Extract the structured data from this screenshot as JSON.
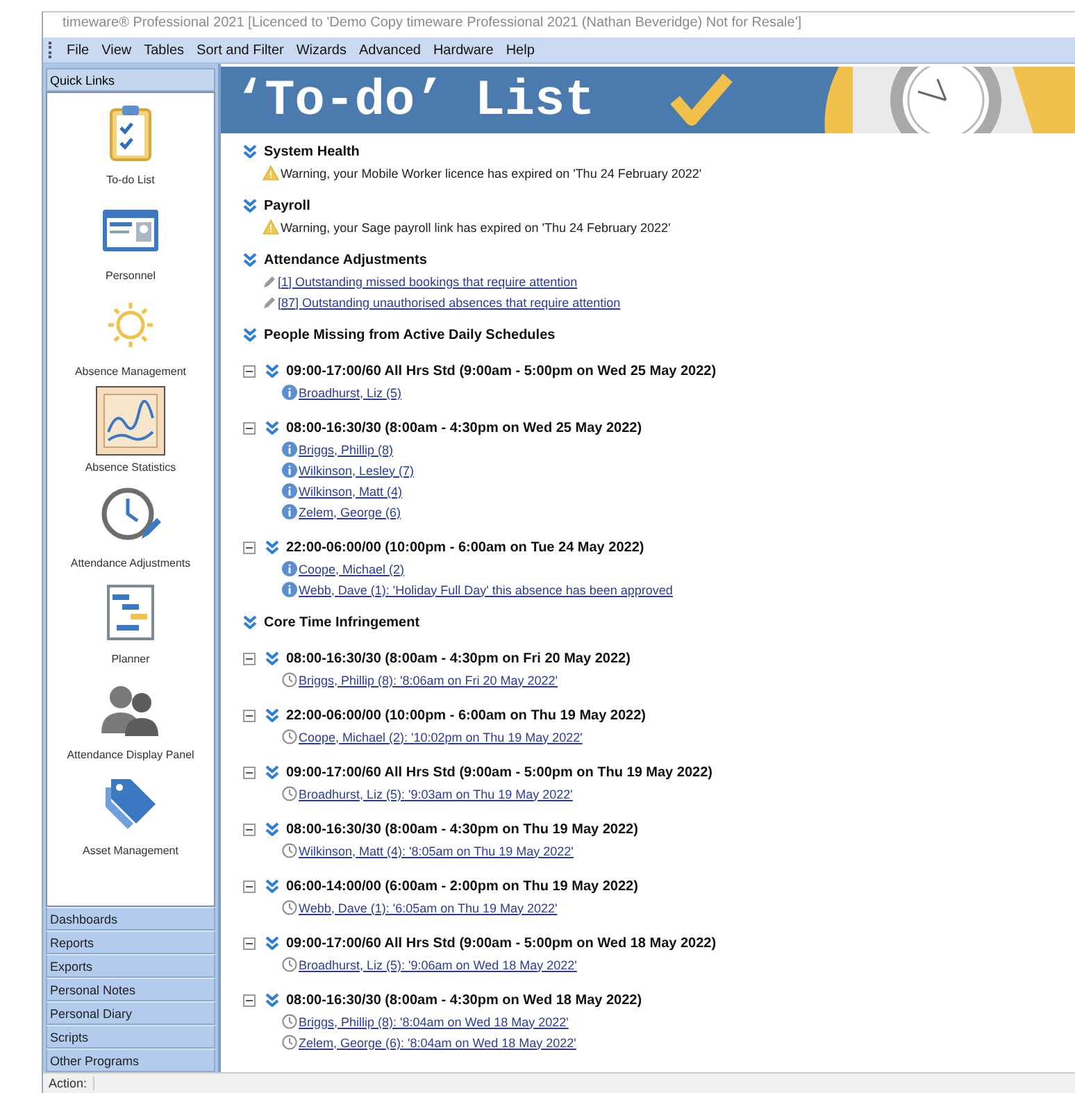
{
  "window": {
    "title": "timeware® Professional 2021 [Licenced to 'Demo Copy timeware Professional 2021 (Nathan Beveridge) Not for Resale']"
  },
  "menu": [
    "File",
    "View",
    "Tables",
    "Sort and Filter",
    "Wizards",
    "Advanced",
    "Hardware",
    "Help"
  ],
  "sidebar": {
    "header": "Quick Links",
    "quick_links": [
      {
        "label": "To-do List",
        "kind": "clipboard",
        "selected": false
      },
      {
        "label": "Personnel",
        "kind": "card",
        "selected": false
      },
      {
        "label": "Absence Management",
        "kind": "sun",
        "selected": false
      },
      {
        "label": "Absence Statistics",
        "kind": "chart",
        "selected": true
      },
      {
        "label": "Attendance Adjustments",
        "kind": "clock",
        "selected": false
      },
      {
        "label": "Planner",
        "kind": "gantt",
        "selected": false
      },
      {
        "label": "Attendance Display Panel",
        "kind": "people",
        "selected": false
      },
      {
        "label": "Asset Management",
        "kind": "tags",
        "selected": false
      }
    ],
    "bottom_items": [
      "Dashboards",
      "Reports",
      "Exports",
      "Personal Notes",
      "Personal Diary",
      "Scripts",
      "Other Programs"
    ]
  },
  "banner": {
    "title": "‘To-do’ List"
  },
  "sections": [
    {
      "title": "System Health",
      "items": [
        {
          "kind": "warning",
          "text": "Warning, your Mobile Worker licence has expired on 'Thu 24 February 2022'"
        }
      ]
    },
    {
      "title": "Payroll",
      "items": [
        {
          "kind": "warning",
          "text": "Warning, your Sage payroll link has expired on 'Thu 24 February 2022'"
        }
      ]
    },
    {
      "title": "Attendance Adjustments",
      "items": [
        {
          "kind": "adjustment",
          "text": "[1] Outstanding missed bookings that require attention"
        },
        {
          "kind": "adjustment",
          "text": "[87] Outstanding unauthorised absences that require attention"
        }
      ]
    },
    {
      "title": "People Missing from Active Daily Schedules",
      "groups": [
        {
          "title": "09:00-17:00/60 All Hrs Std (9:00am - 5:00pm on Wed 25 May 2022)",
          "expanded": true,
          "items": [
            {
              "kind": "info",
              "text": "Broadhurst, Liz (5)"
            }
          ]
        },
        {
          "title": "08:00-16:30/30 (8:00am - 4:30pm on Wed 25 May 2022)",
          "expanded": true,
          "items": [
            {
              "kind": "info",
              "text": "Briggs, Phillip (8)"
            },
            {
              "kind": "info",
              "text": "Wilkinson, Lesley (7)"
            },
            {
              "kind": "info",
              "text": "Wilkinson, Matt (4)"
            },
            {
              "kind": "info",
              "text": "Zelem, George (6)"
            }
          ]
        },
        {
          "title": "22:00-06:00/00 (10:00pm - 6:00am on Tue 24 May 2022)",
          "expanded": true,
          "items": [
            {
              "kind": "info",
              "text": "Coope, Michael (2)"
            },
            {
              "kind": "info",
              "text": "Webb, Dave (1): 'Holiday Full Day' this absence has been approved"
            }
          ]
        }
      ]
    },
    {
      "title": "Core Time Infringement",
      "groups": [
        {
          "title": "08:00-16:30/30 (8:00am - 4:30pm on Fri 20 May 2022)",
          "expanded": true,
          "items": [
            {
              "kind": "clock",
              "text": "Briggs, Phillip (8): '8:06am on Fri 20 May 2022'"
            }
          ]
        },
        {
          "title": "22:00-06:00/00 (10:00pm - 6:00am on Thu 19 May 2022)",
          "expanded": true,
          "items": [
            {
              "kind": "clock",
              "text": "Coope, Michael (2): '10:02pm on Thu 19 May 2022'"
            }
          ]
        },
        {
          "title": "09:00-17:00/60 All Hrs Std (9:00am - 5:00pm on Thu 19 May 2022)",
          "expanded": true,
          "items": [
            {
              "kind": "clock",
              "text": "Broadhurst, Liz (5): '9:03am on Thu 19 May 2022'"
            }
          ]
        },
        {
          "title": "08:00-16:30/30 (8:00am - 4:30pm on Thu 19 May 2022)",
          "expanded": true,
          "items": [
            {
              "kind": "clock",
              "text": "Wilkinson, Matt (4): '8:05am on Thu 19 May 2022'"
            }
          ]
        },
        {
          "title": "06:00-14:00/00 (6:00am - 2:00pm on Thu 19 May 2022)",
          "expanded": true,
          "items": [
            {
              "kind": "clock",
              "text": "Webb, Dave (1): '6:05am on Thu 19 May 2022'"
            }
          ]
        },
        {
          "title": "09:00-17:00/60 All Hrs Std (9:00am - 5:00pm on Wed 18 May 2022)",
          "expanded": true,
          "items": [
            {
              "kind": "clock",
              "text": "Broadhurst, Liz (5): '9:06am on Wed 18 May 2022'"
            }
          ]
        },
        {
          "title": "08:00-16:30/30 (8:00am - 4:30pm on Wed 18 May 2022)",
          "expanded": true,
          "items": [
            {
              "kind": "clock",
              "text": "Briggs, Phillip (8): '8:04am on Wed 18 May 2022'"
            },
            {
              "kind": "clock",
              "text": "Zelem, George (6): '8:04am on Wed 18 May 2022'"
            }
          ]
        }
      ]
    }
  ],
  "status_bar": {
    "label": "Action:"
  }
}
